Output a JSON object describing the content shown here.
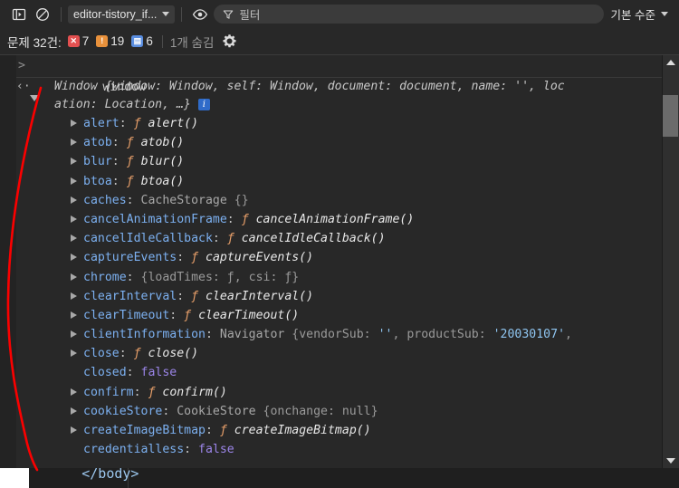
{
  "toolbar": {
    "panel_toggle_icon": "panel-left-icon",
    "clear_console_icon": "no-entry-clear-icon",
    "context_selector": "editor-tistory_if...",
    "eye_icon": "eye-live-expression-icon",
    "filter_icon": "filter-funnel-icon",
    "filter_placeholder": "필터",
    "filter_value": "",
    "level_selector": "기본 수준"
  },
  "issues": {
    "label": "문제 32건:",
    "errors": {
      "icon": "error-badge-icon",
      "glyph": "✕",
      "count": "7",
      "color": "#e35050"
    },
    "warnings": {
      "icon": "warning-badge-icon",
      "glyph": "!",
      "count": "19",
      "color": "#e8913c"
    },
    "infos": {
      "icon": "info-badge-icon",
      "glyph": "▤",
      "count": "6",
      "color": "#5a8ee0"
    },
    "hidden_label": "1개 숨김",
    "settings_icon": "gear-icon"
  },
  "console": {
    "prompt_glyph": ">",
    "input_expression": "window",
    "return_glyph": "‹·",
    "object_head_line1": "Window {window: Window, self: Window, document: document, name: '', loc",
    "object_head_line2": "ation: Location, …}",
    "info_chip": "i",
    "properties": [
      {
        "expandable": true,
        "name": "alert",
        "sep": ": ",
        "kind": "function",
        "fn_marker": "ƒ",
        "fn_text": "alert()"
      },
      {
        "expandable": true,
        "name": "atob",
        "sep": ": ",
        "kind": "function",
        "fn_marker": "ƒ",
        "fn_text": "atob()"
      },
      {
        "expandable": true,
        "name": "blur",
        "sep": ": ",
        "kind": "function",
        "fn_marker": "ƒ",
        "fn_text": "blur()"
      },
      {
        "expandable": true,
        "name": "btoa",
        "sep": ": ",
        "kind": "function",
        "fn_marker": "ƒ",
        "fn_text": "btoa()"
      },
      {
        "expandable": true,
        "name": "caches",
        "sep": ": ",
        "kind": "object",
        "class_text": "CacheStorage ",
        "body_text": "{}"
      },
      {
        "expandable": true,
        "name": "cancelAnimationFrame",
        "sep": ": ",
        "kind": "function",
        "fn_marker": "ƒ",
        "fn_text": "cancelAnimationFrame()"
      },
      {
        "expandable": true,
        "name": "cancelIdleCallback",
        "sep": ": ",
        "kind": "function",
        "fn_marker": "ƒ",
        "fn_text": "cancelIdleCallback()"
      },
      {
        "expandable": true,
        "name": "captureEvents",
        "sep": ": ",
        "kind": "function",
        "fn_marker": "ƒ",
        "fn_text": "captureEvents()"
      },
      {
        "expandable": true,
        "name": "chrome",
        "sep": ": ",
        "kind": "inline_obj",
        "body_text": "{loadTimes: ƒ, csi: ƒ}"
      },
      {
        "expandable": true,
        "name": "clearInterval",
        "sep": ": ",
        "kind": "function",
        "fn_marker": "ƒ",
        "fn_text": "clearInterval()"
      },
      {
        "expandable": true,
        "name": "clearTimeout",
        "sep": ": ",
        "kind": "function",
        "fn_marker": "ƒ",
        "fn_text": "clearTimeout()"
      },
      {
        "expandable": true,
        "name": "clientInformation",
        "sep": ": ",
        "kind": "navigator",
        "class_text": "Navigator ",
        "body_text": "{vendorSub: '', productSub: '20030107',",
        "str1": "''",
        "str2": "'20030107'"
      },
      {
        "expandable": true,
        "name": "close",
        "sep": ": ",
        "kind": "function",
        "fn_marker": "ƒ",
        "fn_text": "close()"
      },
      {
        "expandable": false,
        "name": "closed",
        "sep": ": ",
        "kind": "boolean",
        "bool_text": "false"
      },
      {
        "expandable": true,
        "name": "confirm",
        "sep": ": ",
        "kind": "function",
        "fn_marker": "ƒ",
        "fn_text": "confirm()"
      },
      {
        "expandable": true,
        "name": "cookieStore",
        "sep": ": ",
        "kind": "cookiestore",
        "class_text": "CookieStore ",
        "body_text": "{onchange: null}"
      },
      {
        "expandable": true,
        "name": "createImageBitmap",
        "sep": ": ",
        "kind": "function",
        "fn_marker": "ƒ",
        "fn_text": "createImageBitmap()"
      },
      {
        "expandable": false,
        "name": "credentialless",
        "sep": ": ",
        "kind": "boolean",
        "bool_text": "false"
      }
    ]
  },
  "editor_behind": {
    "line_text": "        </body>"
  },
  "scrollbar": {
    "up_arrow_icon": "scroll-up-arrow-icon",
    "down_arrow_icon": "scroll-down-arrow-icon",
    "thumb": "scrollbar-thumb"
  },
  "annotation": {
    "color": "#ff0000",
    "shape": "hand-drawn-vertical-curve"
  }
}
